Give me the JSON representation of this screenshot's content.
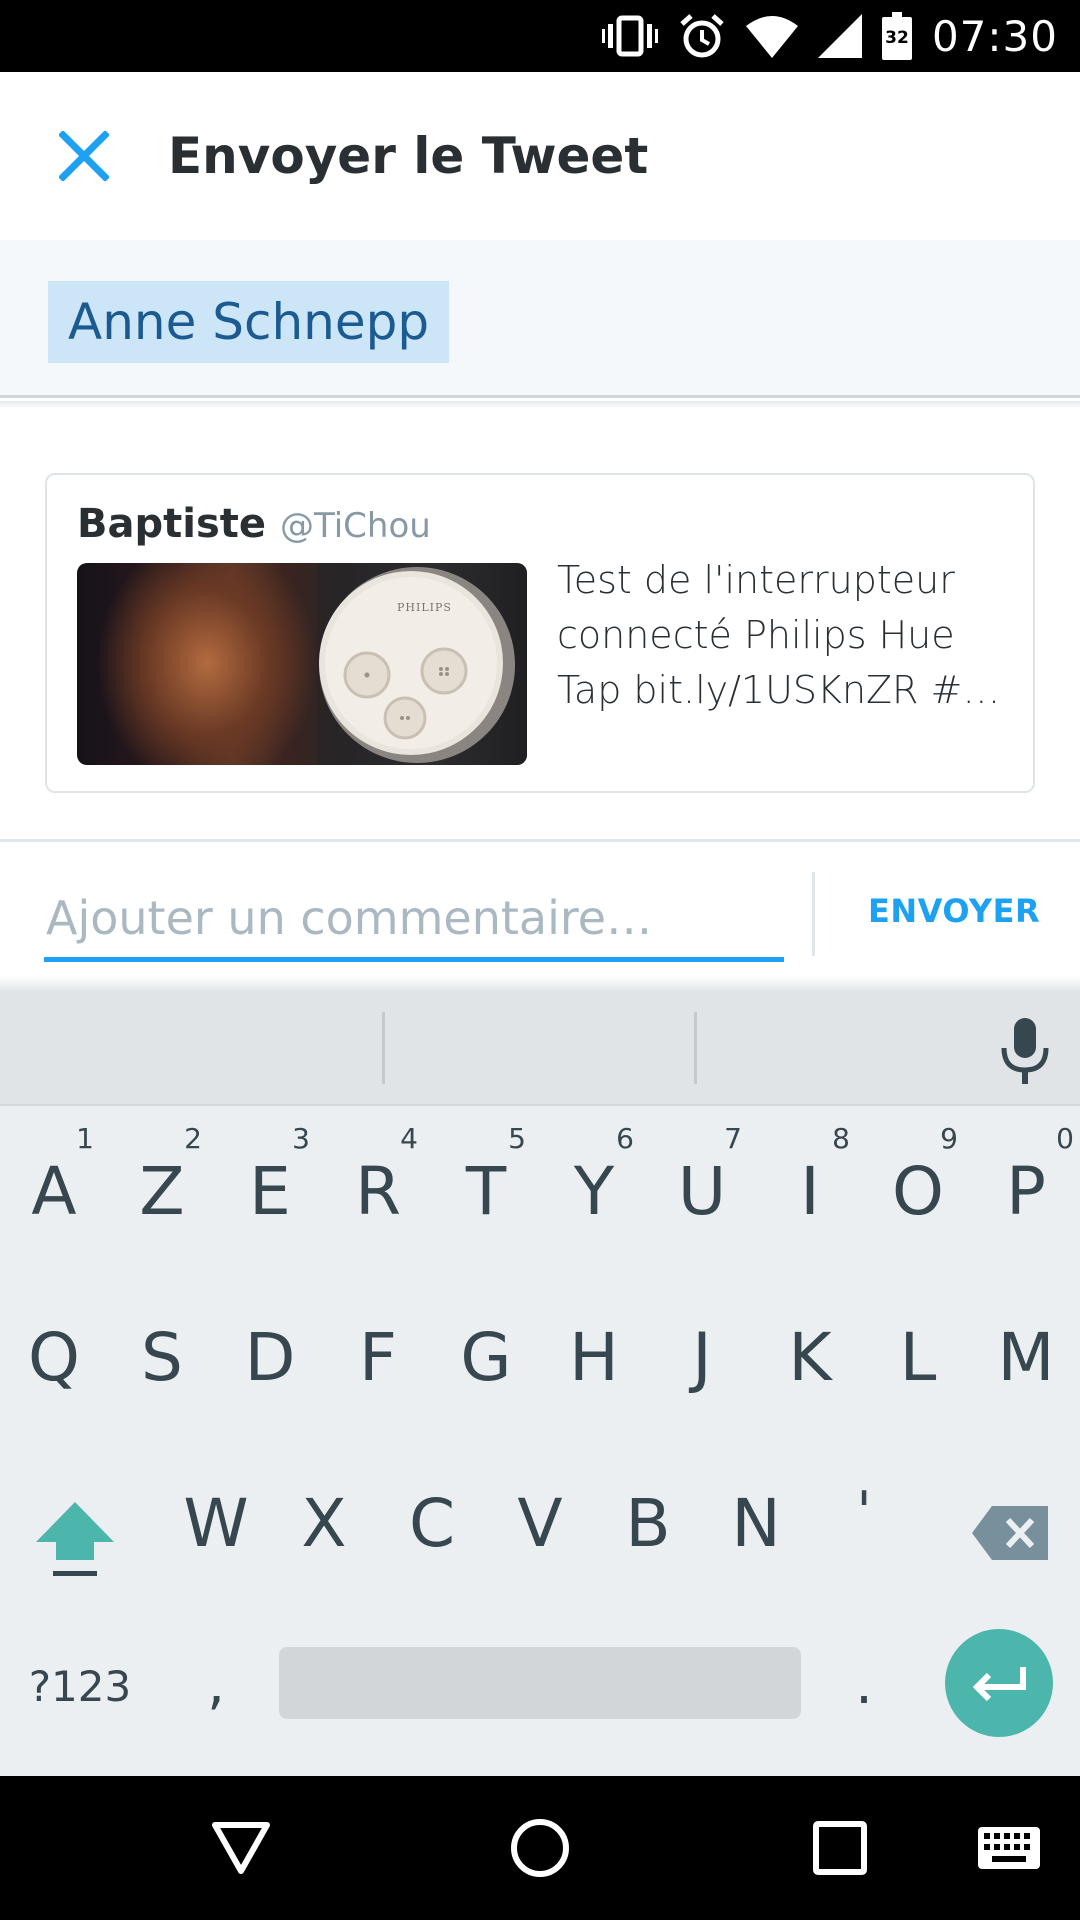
{
  "status_bar": {
    "time": "07:30",
    "battery_level": "32",
    "icons": [
      "vibrate-icon",
      "alarm-icon",
      "wifi-icon",
      "cell-signal-icon",
      "battery-icon"
    ]
  },
  "header": {
    "close_icon": "close-icon",
    "title": "Envoyer le Tweet"
  },
  "recipient": {
    "name": "Anne Schnepp"
  },
  "tweet": {
    "author_name": "Baptiste",
    "author_handle": "@TiChou",
    "text": "Test de l'interrupteur connecté Philips Hue Tap bit.ly/1USKnZR #…",
    "media_label": "PHILIPS"
  },
  "comment": {
    "value": "",
    "placeholder": "Ajouter un commentaire…",
    "send_label": "ENVOYER"
  },
  "colors": {
    "accent": "#1da1f2",
    "chip_bg": "#cde6f7",
    "chip_text": "#1b5b91",
    "keyboard_accent": "#4db6ac"
  },
  "keyboard": {
    "suggestions": [
      "",
      "",
      ""
    ],
    "row1": [
      {
        "key": "A",
        "hint": "1"
      },
      {
        "key": "Z",
        "hint": "2"
      },
      {
        "key": "E",
        "hint": "3"
      },
      {
        "key": "R",
        "hint": "4"
      },
      {
        "key": "T",
        "hint": "5"
      },
      {
        "key": "Y",
        "hint": "6"
      },
      {
        "key": "U",
        "hint": "7"
      },
      {
        "key": "I",
        "hint": "8"
      },
      {
        "key": "O",
        "hint": "9"
      },
      {
        "key": "P",
        "hint": "0"
      }
    ],
    "row2": [
      "Q",
      "S",
      "D",
      "F",
      "G",
      "H",
      "J",
      "K",
      "L",
      "M"
    ],
    "row3": [
      "W",
      "X",
      "C",
      "V",
      "B",
      "N",
      "'"
    ],
    "symbols_label": "?123",
    "comma": ",",
    "period": "."
  },
  "nav_bar": {
    "buttons": [
      "back-icon",
      "home-icon",
      "recents-icon",
      "keyboard-switch-icon"
    ]
  }
}
